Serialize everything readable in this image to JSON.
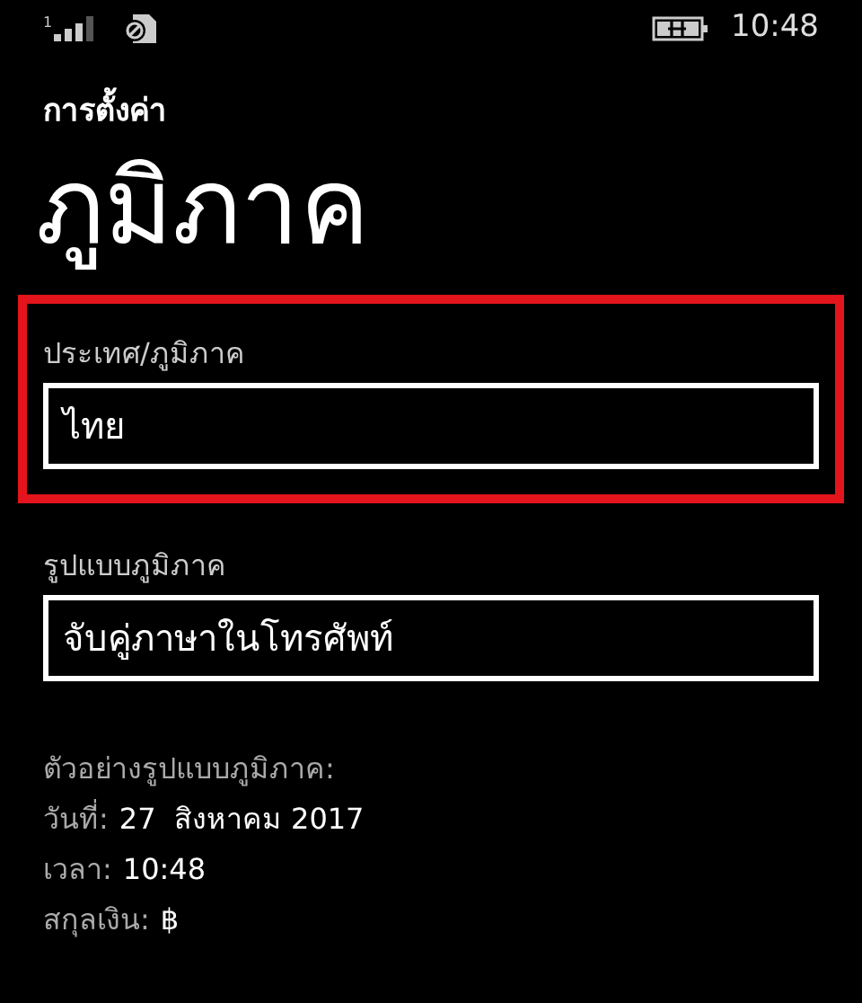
{
  "status_bar": {
    "sim": "1",
    "time": "10:48"
  },
  "app_title": "การตั้งค่า",
  "page_title": "ภูมิภาค",
  "fields": [
    {
      "label": "ประเทศ/ภูมิภาค",
      "value": "ไทย",
      "highlighted": true
    },
    {
      "label": "รูปแบบภูมิภาค",
      "value": "จับคู่ภาษาในโทรศัพท์",
      "highlighted": false
    }
  ],
  "sample": {
    "heading": "ตัวอย่างรูปแบบภูมิภาค:",
    "rows": [
      {
        "label": "วันที่:",
        "value": "27  สิงหาคม 2017"
      },
      {
        "label": "เวลา:",
        "value": "10:48"
      },
      {
        "label": "สกุลเงิน:",
        "value": "฿"
      }
    ]
  }
}
